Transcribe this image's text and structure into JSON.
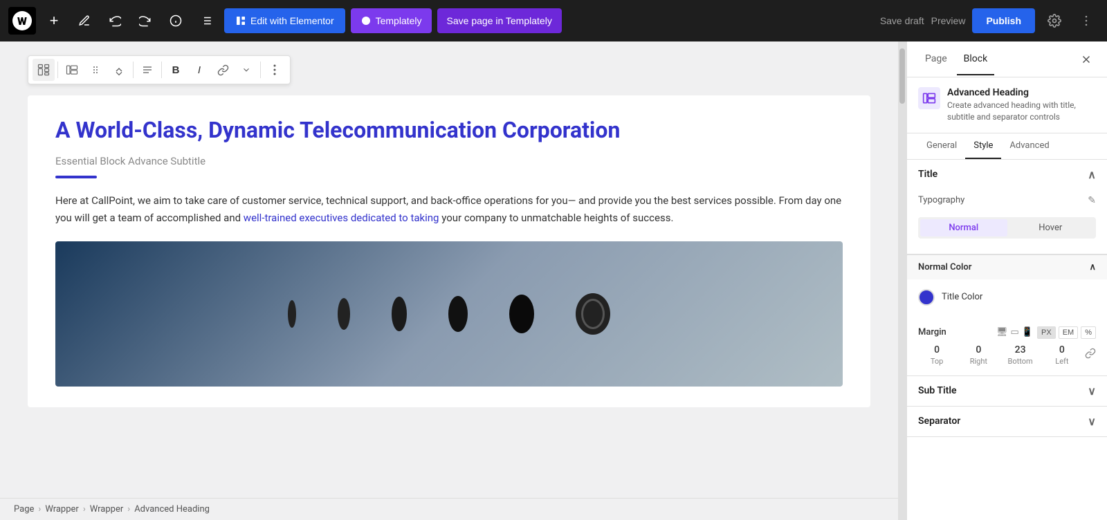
{
  "topbar": {
    "wp_logo": "W",
    "add_label": "+",
    "pen_label": "✏",
    "undo_label": "↩",
    "redo_label": "↪",
    "info_label": "ℹ",
    "list_label": "≡",
    "edit_elementor_label": "Edit with Elementor",
    "templately_label": "Templately",
    "save_templately_label": "Save page in Templately",
    "save_draft_label": "Save draft",
    "preview_label": "Preview",
    "publish_label": "Publish"
  },
  "block_toolbar": {
    "block_icon": "⊞",
    "move_icon": "⠿",
    "updown_icon": "⇅",
    "align_icon": "≡",
    "bold_icon": "B",
    "italic_icon": "I",
    "link_icon": "🔗",
    "more_icon": "⌄",
    "options_icon": "⋮"
  },
  "content": {
    "heading": "A World-Class, Dynamic Telecommunication Corporation",
    "subtitle": "Essential Block Advance Subtitle",
    "body": "Here at CallPoint, we aim to take care of customer service, technical support, and back-office operations for you— and provide you the best services possible. From day one you will get a team of accomplished and well-trained executives dedicated to taking your company to unmatchable heights of success."
  },
  "breadcrumb": {
    "items": [
      "Page",
      "Wrapper",
      "Wrapper",
      "Advanced Heading"
    ],
    "separators": [
      ">",
      ">",
      ">"
    ]
  },
  "panel": {
    "tabs": {
      "page_label": "Page",
      "block_label": "Block"
    },
    "block_info": {
      "name": "Advanced Heading",
      "description": "Create advanced heading with title, subtitle and separator controls"
    },
    "style_tabs": [
      "General",
      "Style",
      "Advanced"
    ],
    "active_style_tab": "Style",
    "title_section": {
      "label": "Title",
      "typography_label": "Typography",
      "state_normal": "Normal",
      "state_hover": "Hover",
      "normal_color_label": "Normal Color",
      "title_color_label": "Title Color",
      "margin_label": "Margin",
      "units": [
        "PX",
        "EM",
        "%"
      ],
      "active_unit": "PX",
      "margin_values": {
        "top": "0",
        "right": "0",
        "bottom": "23",
        "left": "0"
      },
      "margin_sublabels": [
        "Top",
        "Right",
        "Bottom",
        "Left"
      ]
    },
    "subtitle_section": {
      "label": "Sub Title"
    },
    "separator_section": {
      "label": "Separator"
    }
  }
}
